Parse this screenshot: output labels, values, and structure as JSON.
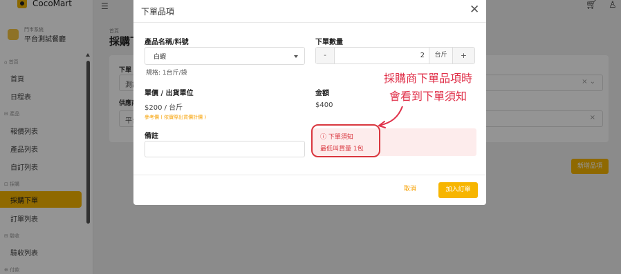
{
  "app": {
    "name": "CocoMart"
  },
  "store": {
    "small": "門市系統",
    "name": "平台測試餐廳"
  },
  "sidebar": {
    "sections": [
      {
        "label": "⌂ 首頁",
        "items": [
          "首頁",
          "日程表"
        ]
      },
      {
        "label": "⊟ 產品",
        "items": [
          "報價列表",
          "產品列表",
          "自訂列表"
        ]
      },
      {
        "label": "⊡ 採購",
        "items": [
          "採購下單",
          "訂單列表"
        ]
      },
      {
        "label": "⊟ 驗收",
        "items": [
          "驗收列表"
        ]
      },
      {
        "label": "⊕ 付款",
        "items": []
      }
    ],
    "active": "採購下單"
  },
  "page": {
    "crumb": "首頁",
    "title": "採購下",
    "field1_label": "下單",
    "field1_value": "測試",
    "field2_label": "供應商",
    "field2_value": "平台",
    "new_button": "新增品項"
  },
  "modal": {
    "title": "下單品項",
    "product": {
      "label": "產品名稱/料號",
      "value": "白蝦",
      "spec": "規格: 1台斤/袋"
    },
    "quantity": {
      "label": "下單數量",
      "minus": "-",
      "value": "2",
      "unit": "台斤",
      "plus": "+"
    },
    "price": {
      "label": "單價 / 出貨單位",
      "value": "$200 / 台斤",
      "hint": "參考價 ( 依實際出貨價計價 )"
    },
    "amount": {
      "label": "金額",
      "value": "$400"
    },
    "remark": {
      "label": "備註",
      "value": ""
    },
    "notice": {
      "title": "ⓘ 下單須知",
      "body": "最低叫貨量 1包"
    },
    "cancel": "取消",
    "submit": "加入訂單"
  },
  "annotation": {
    "line1": "採購商下單品項時",
    "line2": "會看到下單須知"
  },
  "colors": {
    "accent": "#f7b500",
    "danger": "#d9363e",
    "annotation": "#e0314a"
  }
}
